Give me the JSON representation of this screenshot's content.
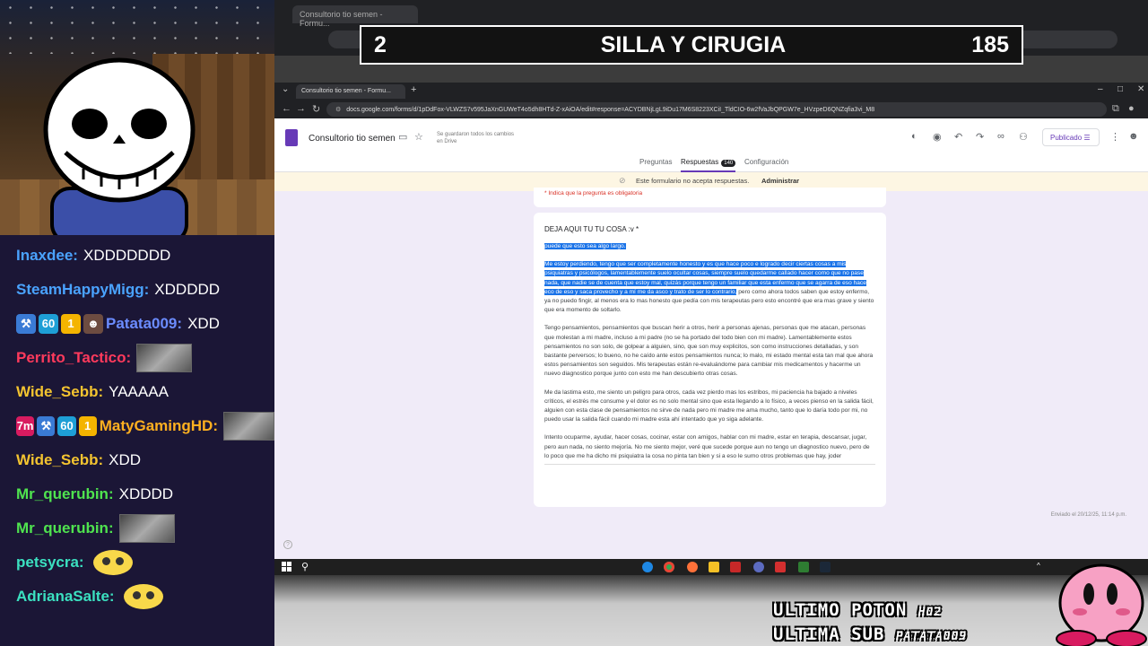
{
  "banner": {
    "number": "2",
    "title": "SILLA Y CIRUGIA",
    "count": "185"
  },
  "chat": [
    {
      "user": "Inaxdee:",
      "color": "#4aa3ff",
      "badges": [],
      "message": "XDDDDDDD",
      "emote": ""
    },
    {
      "user": "SteamHappyMigg:",
      "color": "#4aa3ff",
      "badges": [],
      "message": "XDDDDD",
      "emote": ""
    },
    {
      "user": "Patata009:",
      "color": "#6b8cff",
      "badges": [
        "hammer",
        "60",
        "1",
        "face"
      ],
      "message": "XDD",
      "emote": ""
    },
    {
      "user": "Perrito_Tactico:",
      "color": "#ff3a5c",
      "badges": [],
      "message": "",
      "emote": "picture"
    },
    {
      "user": "Wide_Sebb:",
      "color": "#f4c430",
      "badges": [],
      "message": "YAAAAA",
      "emote": ""
    },
    {
      "user": "MatyGamingHD:",
      "color": "#ffb020",
      "badges": [
        "7m",
        "hammer",
        "60",
        "1"
      ],
      "message": "",
      "emote": "picture"
    },
    {
      "user": "Wide_Sebb:",
      "color": "#f4c430",
      "badges": [],
      "message": "XDD",
      "emote": ""
    },
    {
      "user": "Mr_querubin:",
      "color": "#4fe34f",
      "badges": [],
      "message": "XDDDD",
      "emote": ""
    },
    {
      "user": "Mr_querubin:",
      "color": "#4fe34f",
      "badges": [],
      "message": "",
      "emote": "picture"
    },
    {
      "user": "petsycra:",
      "color": "#3be0c0",
      "badges": [],
      "message": "",
      "emote": "face"
    },
    {
      "user": "AdrianaSalte:",
      "color": "#3be0c0",
      "badges": [],
      "message": "",
      "emote": "face"
    }
  ],
  "browser": {
    "tab_title": "Consultorio tio semen - Formu...",
    "new_tab": "+",
    "url": "docs.google.com/forms/d/1pDdFox-VLWZS7v595JaXnGUWeT4o5dh8HTd-Z-xAiOA/edit#response=ACYDBNjLgL9iDu17M6S8223XCiI_TldCIO-6w2fVaJbQPGW7e_HVzpeD6QNZqfia3vi_M8",
    "bg_tab_title": "Consultorio tio semen - Formu..."
  },
  "form": {
    "title": "Consultorio tio semen",
    "saved_status": "Se guardaron todos los cambios en Drive",
    "publish_label": "Publicado",
    "tabs": [
      "Preguntas",
      "Respuestas",
      "Configuración"
    ],
    "responses_count": "140",
    "notice": "Este formulario no acepta respuestas.",
    "notice_action": "Administrar",
    "required_note": "* Indica que la pregunta es obligatoria",
    "question": "DEJA AQUI TU TU COSA :v *",
    "answer_highlight_1": "puede que esto sea algo largo.",
    "answer_highlight_2": "Me estoy perdiendo, tengo que ser completamente honesto y es que hace poco e logrado decir ciertas cosas a mis psiquiatras y psicólogos, lamentablemente suelo ocultar cosas, siempre suelo quedarme callado hacer como que no pase nada, que nadie se de cuenta que estoy mal, quizás porque tengo un familiar que esta enfermo que se agarra de eso hace eco de eso y saca provecho y a mí me da asco y trato de ser lo contrario,",
    "answer_rest_1": " pero como ahora todos saben que estoy enfermo, ya no puedo fingir, al menos era lo mas honesto que pedía con mis terapeutas pero esto encontré que era mas grave y siento que era momento de soltarlo.",
    "answer_p2": "Tengo pensamientos, pensamientos que buscan herir a otros, herir a personas ajenas, personas que me atacan, personas que molestan a mi madre, incluso a mi padre (no se ha portado del todo bien con mi madre). Lamentablemente estos pensamientos no son solo, de golpear a alguien, sino, que son muy explicitos, son como instrucciones detalladas, y son bastante perversos; lo bueno, no he caído ante estos pensamientos nunca; lo malo, mi estado mental esta tan mal que ahora estos pensamientos son seguidos. Mis terapeutas están re-evaluándome para cambiar mis medicamentos y hacerme un nuevo diagnostico porque junto con esto me han descubierto otras cosas.",
    "answer_p3": "Me da lastima esto, me siento un peligro para otros, cada vez pierdo mas los estribos, mi paciencia ha bajado a niveles críticos, el estrés me consume y el dolor es no solo mental sino que esta llegando a lo físico, a veces pienso en la salida fácil, alguien con esta clase de pensamientos no sirve de nada pero mi madre me ama mucho, tanto que lo daría todo por mi, no puedo usar la salida fácil cuando mi madre esta ahí intentado que yo siga adelante.",
    "answer_p4": "Intento ocuparme, ayudar, hacer cosas, cocinar, estar con amigos, hablar con mi madre, estar en terapia, descansar, jugar, pero aun nada, no siento mejoría. No me siento mejor, veré que sucede porque aun no tengo un diagnostico nuevo, pero de lo poco que me ha dicho mi psiquiatra la cosa no pinta tan bien y si a eso le sumo otros problemas que hay, joder",
    "submitted": "Enviado el 20/12/25, 11:14 p.m."
  },
  "overlay": {
    "line1": "ULTIMO POTON",
    "line1_suffix": "H02",
    "line2": "ULTIMA SUB",
    "line2_suffix": "PATATA009"
  },
  "colors": {
    "accent": "#673ab7",
    "chat_bg": "#1b1636",
    "highlight": "#1a73e8"
  }
}
